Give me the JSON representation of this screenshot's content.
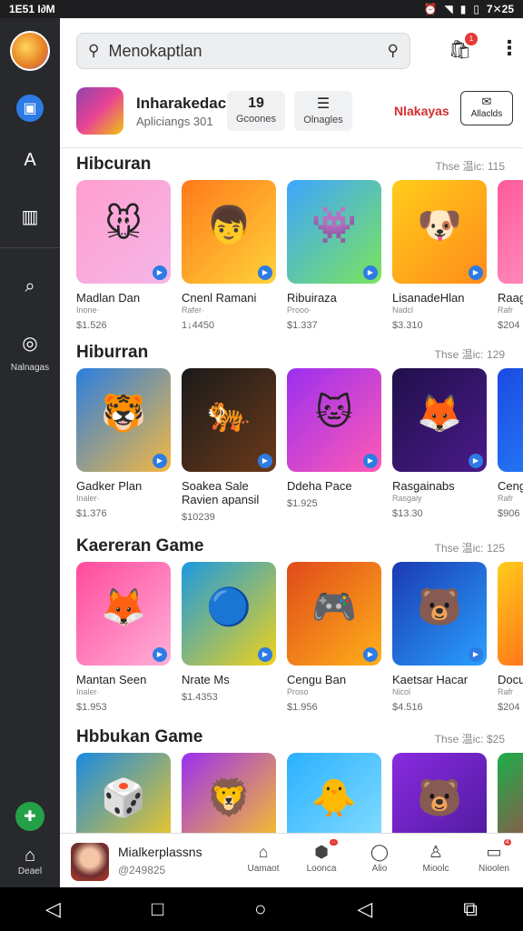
{
  "status": {
    "time": "1E51 I∂M",
    "right": "7✕25"
  },
  "sidebar": {
    "items": [
      {
        "icon": "wallet-icon",
        "glyph": "▣"
      },
      {
        "icon": "store-icon",
        "glyph": "A"
      },
      {
        "icon": "chart-icon",
        "glyph": "▥"
      },
      {
        "icon": "search-icon",
        "glyph": "⌕"
      },
      {
        "icon": "location-icon",
        "glyph": "◎"
      }
    ],
    "location_label": "Nalnagas",
    "home_label": "Deael"
  },
  "search": {
    "value": "Menokaptlan"
  },
  "cart": {
    "badge": "1"
  },
  "app": {
    "name": "Inharakedac",
    "subtitle": "Apliciangs 301",
    "stat1_num": "19",
    "stat1_label": "Gcoones",
    "stat2_label": "Olnagles",
    "link": "Nlakayas",
    "button_label": "Allaclds"
  },
  "sections": [
    {
      "title": "Hibcuran",
      "more": "Thse 温ic: 115",
      "cards": [
        {
          "title": "Madlan Dan",
          "sub": "Inone·",
          "price": "$1.526",
          "c1": "#ff9ecf",
          "c2": "#f4b6e8",
          "glyph": "🐭"
        },
        {
          "title": "Cnenl Ramani",
          "sub": "Rafer·",
          "price": "1↓4450",
          "c1": "#ff7a1a",
          "c2": "#ffd23a",
          "glyph": "👦"
        },
        {
          "title": "Ribuiraza",
          "sub": "Prooo·",
          "price": "$1.337",
          "c1": "#3da5ff",
          "c2": "#7ce45c",
          "glyph": "👾"
        },
        {
          "title": "LisanadeHlan",
          "sub": "Nadcl",
          "price": "$3.310",
          "c1": "#ffcc1a",
          "c2": "#ff8c1a",
          "glyph": "🐶"
        },
        {
          "title": "Raag",
          "sub": "Rafr",
          "price": "$204",
          "c1": "#ff5a9c",
          "c2": "#ffa0c8",
          "glyph": "🐭"
        }
      ]
    },
    {
      "title": "Hiburran",
      "more": "Thse 温ic: 129",
      "cards": [
        {
          "title": "Gadker Plan",
          "sub": "Inaler·",
          "price": "$1.376",
          "c1": "#2a7ee0",
          "c2": "#f5b842",
          "glyph": "🐯"
        },
        {
          "title": "Soakea Sale Ravien apansil",
          "sub": "",
          "price": "$10239",
          "c1": "#1a1a1a",
          "c2": "#6b3a1a",
          "glyph": "🐅"
        },
        {
          "title": "Ddeha Pace",
          "sub": "",
          "price": "$1.925",
          "c1": "#9b2ff0",
          "c2": "#ff5ab4",
          "glyph": "🐱"
        },
        {
          "title": "Rasgainabs",
          "sub": "Rasgaiy",
          "price": "$13.30",
          "c1": "#20104a",
          "c2": "#4a1a8a",
          "glyph": "🦊"
        },
        {
          "title": "Ceng",
          "sub": "Rafr",
          "price": "$906",
          "c1": "#1a4ae0",
          "c2": "#2a8aff",
          "glyph": "🐸"
        }
      ]
    },
    {
      "title": "Kaereran Game",
      "more": "Thse 温ic: 125",
      "cards": [
        {
          "title": "Mantan Seen",
          "sub": "Inaler·",
          "price": "$1.953",
          "c1": "#ff4a9c",
          "c2": "#ffb0d8",
          "glyph": "🦊"
        },
        {
          "title": "Nrate Ms",
          "sub": "",
          "price": "$1.4353",
          "c1": "#1a9ae0",
          "c2": "#f0d21a",
          "glyph": "🔵"
        },
        {
          "title": "Cengu Ban",
          "sub": "Proso",
          "price": "$1.956",
          "c1": "#e04a1a",
          "c2": "#ffb01a",
          "glyph": "🎮"
        },
        {
          "title": "Kaetsar Hacar",
          "sub": "Nicol",
          "price": "$4.516",
          "c1": "#1a3ab0",
          "c2": "#2aa0ff",
          "glyph": "🐻"
        },
        {
          "title": "Docu",
          "sub": "Rafr",
          "price": "$204",
          "c1": "#ffcc1a",
          "c2": "#ff4a1a",
          "glyph": "🔺"
        }
      ]
    },
    {
      "title": "Hbbukan Game",
      "more": "Thse 温ic: $25",
      "cards": [
        {
          "title": "",
          "sub": "",
          "price": "",
          "c1": "#1a8ae0",
          "c2": "#ffcc1a",
          "glyph": "🎲"
        },
        {
          "title": "",
          "sub": "",
          "price": "",
          "c1": "#9b2ff0",
          "c2": "#ffcc1a",
          "glyph": "🦁"
        },
        {
          "title": "",
          "sub": "",
          "price": "",
          "c1": "#2ab0ff",
          "c2": "#8ae0ff",
          "glyph": "🐥"
        },
        {
          "title": "",
          "sub": "",
          "price": "",
          "c1": "#8a2ae0",
          "c2": "#4a1a9a",
          "glyph": "🐻"
        },
        {
          "title": "",
          "sub": "",
          "price": "",
          "c1": "#1ab04a",
          "c2": "#e01a4a",
          "glyph": "🎯"
        }
      ]
    }
  ],
  "bottom": {
    "profile_name": "Mialkerplassns",
    "profile_handle": "@249825",
    "nav": [
      {
        "icon": "home-icon",
        "glyph": "⌂",
        "label": "Uamaot"
      },
      {
        "icon": "cube-icon",
        "glyph": "⬢",
        "label": "Loonca",
        "badge": "··"
      },
      {
        "icon": "pin-icon",
        "glyph": "◯",
        "label": "Alio"
      },
      {
        "icon": "user-icon",
        "glyph": "♙",
        "label": "Mioolc"
      },
      {
        "icon": "chat-icon",
        "glyph": "▭",
        "label": "Nioolen",
        "badge": "4"
      }
    ]
  },
  "system_nav": {
    "back": "◁",
    "home": "○",
    "recent": "□",
    "back2": "◁",
    "menu": "⧉"
  }
}
